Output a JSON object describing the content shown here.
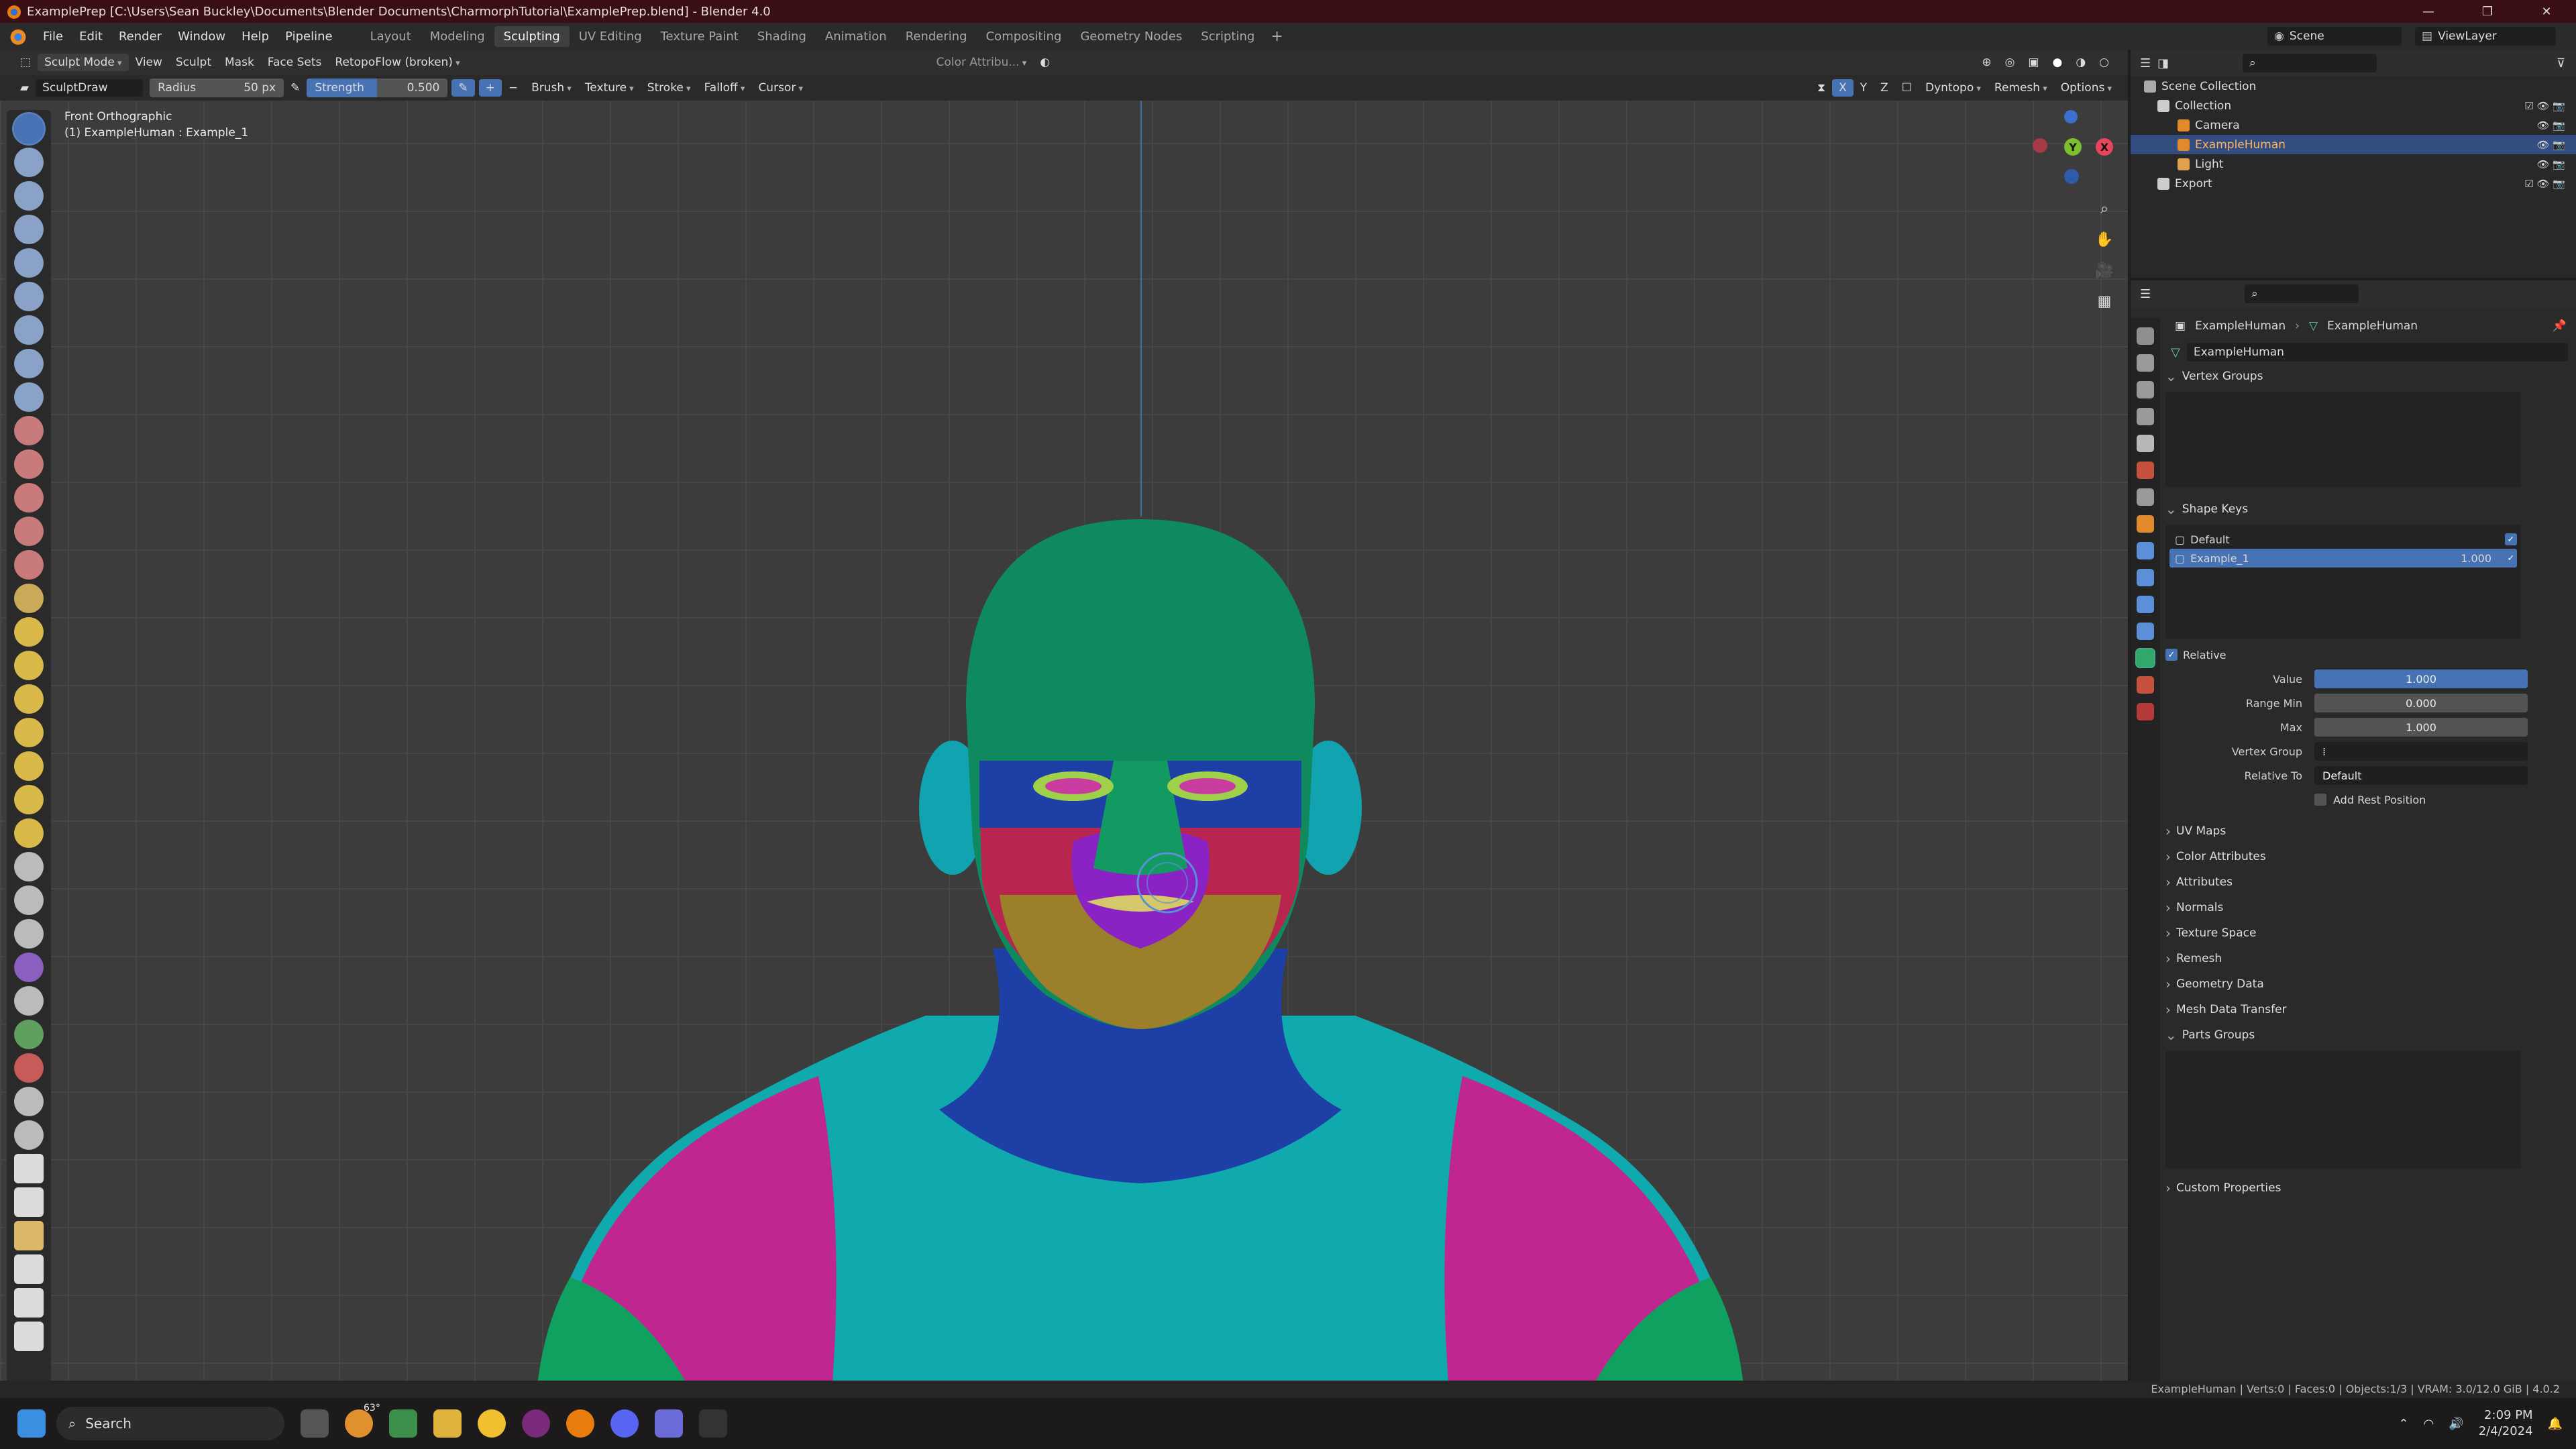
{
  "window": {
    "title": "ExamplePrep [C:\\Users\\Sean Buckley\\Documents\\Blender Documents\\CharmorphTutorial\\ExamplePrep.blend] - Blender 4.0",
    "controls": [
      "—",
      "❐",
      "✕"
    ]
  },
  "menubar": {
    "menus": [
      "File",
      "Edit",
      "Render",
      "Window",
      "Help",
      "Pipeline"
    ],
    "workspaces": [
      "Layout",
      "Modeling",
      "Sculpting",
      "UV Editing",
      "Texture Paint",
      "Shading",
      "Animation",
      "Rendering",
      "Compositing",
      "Geometry Nodes",
      "Scripting"
    ],
    "active_workspace": "Sculpting",
    "scene_label": "Scene",
    "viewlayer_label": "ViewLayer"
  },
  "viewport_header": {
    "mode": "Sculpt Mode",
    "menus": [
      "View",
      "Sculpt",
      "Mask",
      "Face Sets"
    ],
    "retopo": "RetopoFlow (broken)",
    "color_attr": "Color Attribu...",
    "axes": [
      "X",
      "Y",
      "Z"
    ],
    "right_menus": [
      "Dyntopo",
      "Remesh",
      "Options"
    ]
  },
  "tool_header": {
    "brush_name": "SculptDraw",
    "radius_label": "Radius",
    "radius_value": "50 px",
    "strength_label": "Strength",
    "strength_value": "0.500",
    "menus": [
      "Brush",
      "Texture",
      "Stroke",
      "Falloff",
      "Cursor"
    ]
  },
  "viewport": {
    "view_name": "Front Orthographic",
    "object_info": "(1) ExampleHuman : Example_1"
  },
  "outliner": {
    "root": "Scene Collection",
    "items": [
      {
        "label": "Collection",
        "indent": 1
      },
      {
        "label": "Camera",
        "indent": 2
      },
      {
        "label": "ExampleHuman",
        "indent": 2,
        "selected": true
      },
      {
        "label": "Light",
        "indent": 2
      },
      {
        "label": "Export",
        "indent": 1
      }
    ]
  },
  "properties": {
    "breadcrumb_object": "ExampleHuman",
    "breadcrumb_mesh": "ExampleHuman",
    "mesh_name": "ExampleHuman",
    "vertex_groups_title": "Vertex Groups",
    "shape_keys_title": "Shape Keys",
    "shape_keys": [
      {
        "name": "Default",
        "value": ""
      },
      {
        "name": "Example_1",
        "value": "1.000"
      }
    ],
    "relative_label": "Relative",
    "value_label": "Value",
    "value": "1.000",
    "range_min_label": "Range Min",
    "range_min": "0.000",
    "max_label": "Max",
    "max": "1.000",
    "vertex_group_label": "Vertex Group",
    "relative_to_label": "Relative To",
    "relative_to": "Default",
    "add_rest_label": "Add Rest Position",
    "collapsed_panels": [
      "UV Maps",
      "Color Attributes",
      "Attributes",
      "Normals",
      "Texture Space",
      "Remesh",
      "Geometry Data",
      "Mesh Data Transfer"
    ],
    "parts_groups_title": "Parts Groups",
    "custom_properties_title": "Custom Properties"
  },
  "statusbar": {
    "text": "ExampleHuman | Verts:0 | Faces:0 | Objects:1/3 | VRAM: 3.0/12.0 GiB | 4.0.2"
  },
  "taskbar": {
    "search_placeholder": "Search",
    "weather_temp": "63°",
    "time": "2:09 PM",
    "date": "2/4/2024"
  },
  "colors": {
    "accent_blue": "#4772b3",
    "selected_row": "#334d80",
    "titlebar": "#3a0f14",
    "mesh_green": "#0f8a5f",
    "mesh_teal": "#10b0b0",
    "mesh_blue": "#1d3fa6",
    "mesh_red": "#b8264f",
    "mesh_magenta": "#c0268f",
    "mesh_olive": "#9c7f2a",
    "mesh_purple": "#8a22c4"
  }
}
